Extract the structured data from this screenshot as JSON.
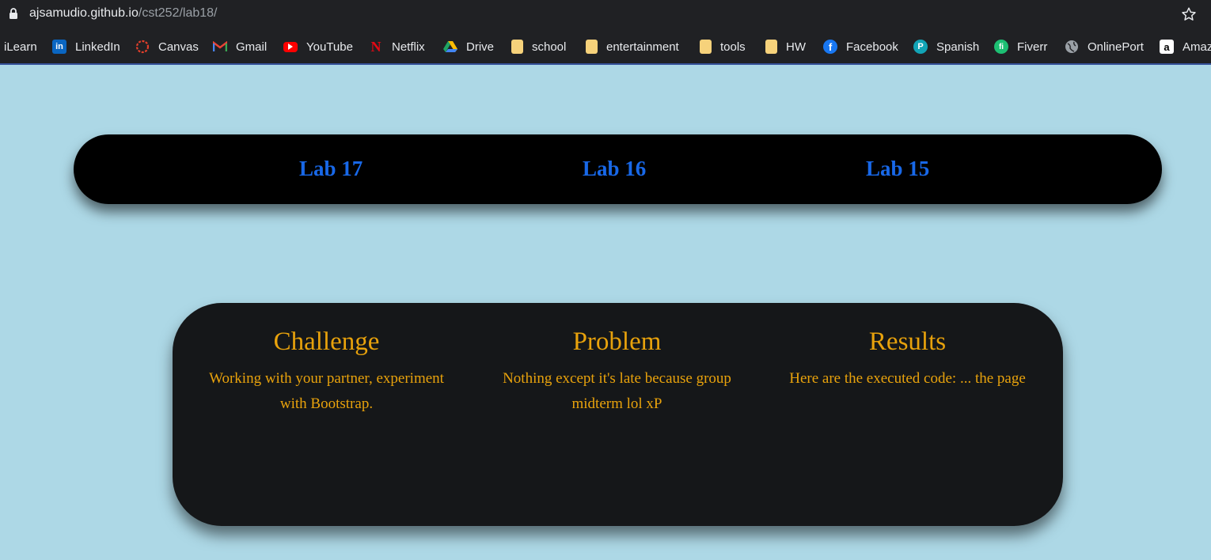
{
  "browser": {
    "url_host": "ajsamudio.github.io",
    "url_path": "/cst252/lab18/"
  },
  "bookmarks": [
    {
      "label": "iLearn",
      "icon": "none"
    },
    {
      "label": "LinkedIn",
      "icon": "linkedin-icon",
      "color": "#0a66c2"
    },
    {
      "label": "Canvas",
      "icon": "canvas-icon",
      "color": "#e13f2b"
    },
    {
      "label": "Gmail",
      "icon": "gmail-icon",
      "color": "#ea4335"
    },
    {
      "label": "YouTube",
      "icon": "youtube-icon",
      "color": "#ff0000"
    },
    {
      "label": "Netflix",
      "icon": "netflix-icon",
      "color": "#e50914"
    },
    {
      "label": "Drive",
      "icon": "drive-icon",
      "color": "#1fa463"
    },
    {
      "label": "school",
      "icon": "folder-icon",
      "color": "#f6d27b"
    },
    {
      "label": "entertainment",
      "icon": "folder-icon",
      "color": "#f6d27b"
    },
    {
      "label": "tools",
      "icon": "folder-icon",
      "color": "#f6d27b"
    },
    {
      "label": "HW",
      "icon": "folder-icon",
      "color": "#f6d27b"
    },
    {
      "label": "Facebook",
      "icon": "facebook-icon",
      "color": "#1877f2"
    },
    {
      "label": "Spanish",
      "icon": "spanish-icon",
      "color": "#12a4b6"
    },
    {
      "label": "Fiverr",
      "icon": "fiverr-icon",
      "color": "#1dbf73"
    },
    {
      "label": "OnlinePort",
      "icon": "globe-icon",
      "color": "#9aa0a6"
    },
    {
      "label": "Amaz",
      "icon": "amazon-icon",
      "color": "#ffffff"
    }
  ],
  "nav": {
    "links": [
      "Lab 17",
      "Lab 16",
      "Lab 15"
    ]
  },
  "sections": [
    {
      "title": "Challenge",
      "text": "Working with your partner, experiment with Bootstrap."
    },
    {
      "title": "Problem",
      "text": "Nothing except it's late because group midterm lol xP"
    },
    {
      "title": "Results",
      "text": "Here are the executed code: ... the page"
    }
  ],
  "colors": {
    "page_bg": "#add8e6",
    "link": "#1868e8",
    "accent": "#e8a20c",
    "card_bg": "#151719"
  }
}
